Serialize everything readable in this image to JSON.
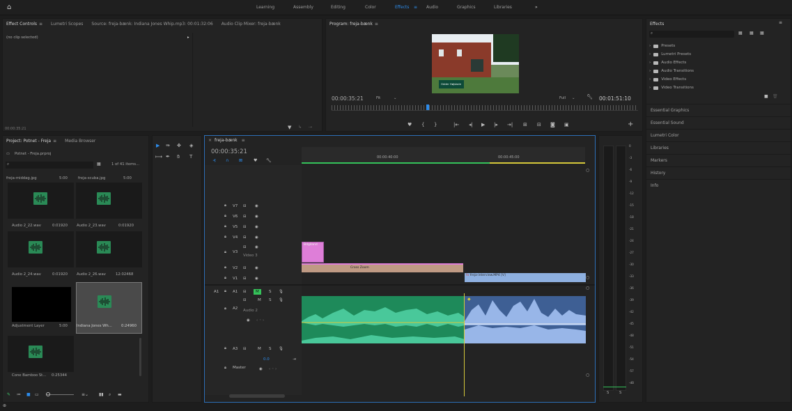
{
  "workspace_tabs": [
    "Learning",
    "Assembly",
    "Editing",
    "Color",
    "Effects",
    "Audio",
    "Graphics",
    "Libraries"
  ],
  "more_icon": "»",
  "effect_controls": {
    "tabs": [
      "Effect Controls",
      "Lumetri Scopes",
      "Source: freja-bænk: Indiana Jones Whip.mp3: 00:01:32:06",
      "Audio Clip Mixer: freja-bænk"
    ],
    "no_clip": "(no clip selected)",
    "timecode": "00:00:35:21"
  },
  "program": {
    "title": "Program: freja-bænk",
    "timecode": "00:00:35:21",
    "fit": "Fit",
    "quality": "Full",
    "duration": "00:01:51:10",
    "lower_third": "Odder Højskole"
  },
  "effects_panel": {
    "title": "Effects",
    "search_placeholder": "",
    "folders": [
      "Presets",
      "Lumetri Presets",
      "Audio Effects",
      "Audio Transitions",
      "Video Effects",
      "Video Transitions"
    ],
    "sections": [
      "Essential Graphics",
      "Essential Sound",
      "Lumetri Color",
      "Libraries",
      "Markers",
      "History",
      "Info"
    ]
  },
  "project": {
    "tabs": [
      "Project: Potnet - Freja",
      "Media Browser"
    ],
    "file": "Potnet - Freja.prproj",
    "count": "1 of 41 items...",
    "items": [
      {
        "name": "freja-middag.jpg",
        "dur": "5:00"
      },
      {
        "name": "freja-scuba.jpg",
        "dur": "5:00"
      },
      {
        "name": "Audio 2_22.wav",
        "dur": "0:01920"
      },
      {
        "name": "Audio 2_23.wav",
        "dur": "0:01920"
      },
      {
        "name": "Audio 2_24.wav",
        "dur": "0:01920"
      },
      {
        "name": "Audio 2_26.wav",
        "dur": "12:02468"
      },
      {
        "name": "Adjustment Layer",
        "dur": "5:00"
      },
      {
        "name": "Indiana Jones Wh...",
        "dur": "0:24960"
      },
      {
        "name": "Cone Bamboo St...",
        "dur": "0:25344"
      }
    ]
  },
  "timeline": {
    "seq_tab": "freja-bænk",
    "timecode": "00:00:35:21",
    "ruler": [
      "00:00:40:00",
      "00:00:45:00"
    ],
    "video_tracks": [
      "V7",
      "V6",
      "V5",
      "V4",
      "V3",
      "V2",
      "V1"
    ],
    "video3_name": "Video 3",
    "audio_tracks": [
      "A1",
      "A2",
      "A3"
    ],
    "audio2_name": "Audio 2",
    "master": "Master",
    "master_value": "0.0",
    "a1_target": "A1",
    "clips": {
      "v3": "Bdgiland",
      "v2": "Cross Zoom",
      "v1": "freja-interview.MP4 [V]"
    }
  },
  "meter": {
    "scale": [
      "0",
      "-3",
      "-6",
      "-9",
      "-12",
      "-15",
      "-18",
      "-21",
      "-24",
      "-27",
      "-30",
      "-33",
      "-36",
      "-39",
      "-42",
      "-45",
      "-48",
      "-51",
      "-54",
      "-57",
      "-dB"
    ],
    "solo": [
      "S",
      "S"
    ]
  }
}
